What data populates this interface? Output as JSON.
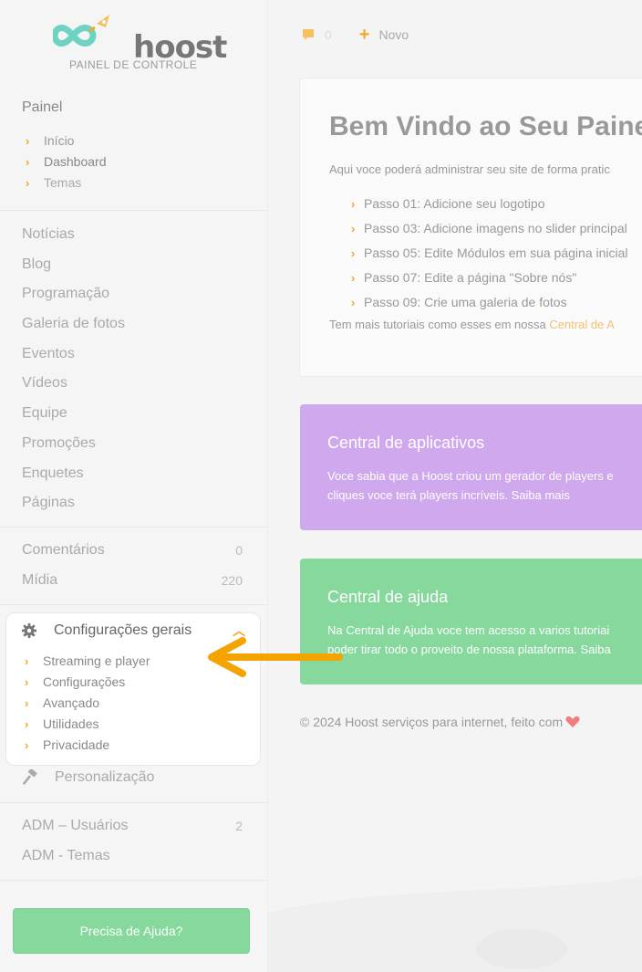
{
  "logo": {
    "word": "hoost",
    "subtitle": "PAINEL DE CONTROLE"
  },
  "sidebar": {
    "panel_title": "Painel",
    "panel_items": [
      "Início",
      "Dashboard",
      "Temas"
    ],
    "content_items": [
      {
        "label": "Notícias"
      },
      {
        "label": "Blog"
      },
      {
        "label": "Programação"
      },
      {
        "label": "Galeria de fotos"
      },
      {
        "label": "Eventos"
      },
      {
        "label": "Vídeos"
      },
      {
        "label": "Equipe"
      },
      {
        "label": "Promoções"
      },
      {
        "label": "Enquetes"
      },
      {
        "label": "Páginas"
      }
    ],
    "media_items": [
      {
        "label": "Comentários",
        "count": "0"
      },
      {
        "label": "Mídia",
        "count": "220"
      }
    ],
    "config": {
      "title": "Configurações gerais",
      "items": [
        "Streaming e player",
        "Configurações",
        "Avançado",
        "Utilidades",
        "Privacidade"
      ]
    },
    "personalization": "Personalização",
    "admin_items": [
      {
        "label": "ADM – Usuários",
        "count": "2"
      },
      {
        "label": "ADM - Temas",
        "count": ""
      }
    ],
    "help_button": "Precisa de Ajuda?"
  },
  "topbar": {
    "comment_count": "0",
    "new_label": "Novo"
  },
  "welcome": {
    "title": "Bem Vindo ao Seu Painel",
    "intro": "Aqui voce poderá administrar seu site de forma pratic",
    "steps": [
      "Passo 01: Adicione seu logotipo",
      "Passo 03: Adicione imagens no slider principal",
      "Passo 05: Edite Módulos em sua página inicial",
      "Passo 07: Edite a página \"Sobre nós\"",
      "Passo 09: Crie uma galeria de fotos"
    ],
    "more_text": "Tem mais tutoriais como esses em nossa ",
    "more_link": "Central de A"
  },
  "apps_card": {
    "title": "Central de aplicativos",
    "line1": "Voce sabia que a Hoost criou um gerador de players e",
    "line2": "cliques voce terá players incríveis. Saiba mais"
  },
  "help_card": {
    "title": "Central de ajuda",
    "line1": "Na Central de Ajuda voce tem acesso a varios tutoriai",
    "line2": "poder tirar todo o proveito de nossa plataforma. Saiba"
  },
  "footer": {
    "text": "© 2024 Hoost serviços para internet, feito com"
  },
  "colors": {
    "accent": "#f4a72a",
    "apps": "#cfa8ee",
    "help": "#86d89d",
    "heart": "#f07c7c",
    "logo": "#6fd3c4"
  }
}
